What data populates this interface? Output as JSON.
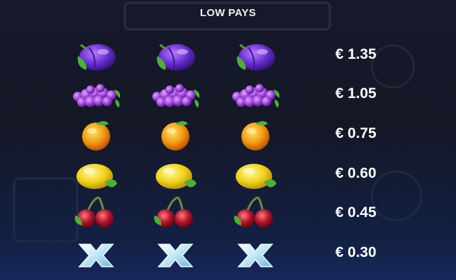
{
  "title": "LOW PAYS",
  "rows": [
    {
      "symbol": "plum-icon",
      "price": "€ 1.35"
    },
    {
      "symbol": "grapes-icon",
      "price": "€ 1.05"
    },
    {
      "symbol": "orange-icon",
      "price": "€ 0.75"
    },
    {
      "symbol": "lemon-icon",
      "price": "€ 0.60"
    },
    {
      "symbol": "cherries-icon",
      "price": "€ 0.45"
    },
    {
      "symbol": "x-icon",
      "price": "€ 0.30"
    }
  ],
  "colors": {
    "plum": "#6a2fd0",
    "grape": "#9a3fd6",
    "orange": "#f29a12",
    "lemon": "#f2d21a",
    "cherry": "#b0122a",
    "x": "#bfe6f5",
    "leaf": "#4caf3a"
  }
}
